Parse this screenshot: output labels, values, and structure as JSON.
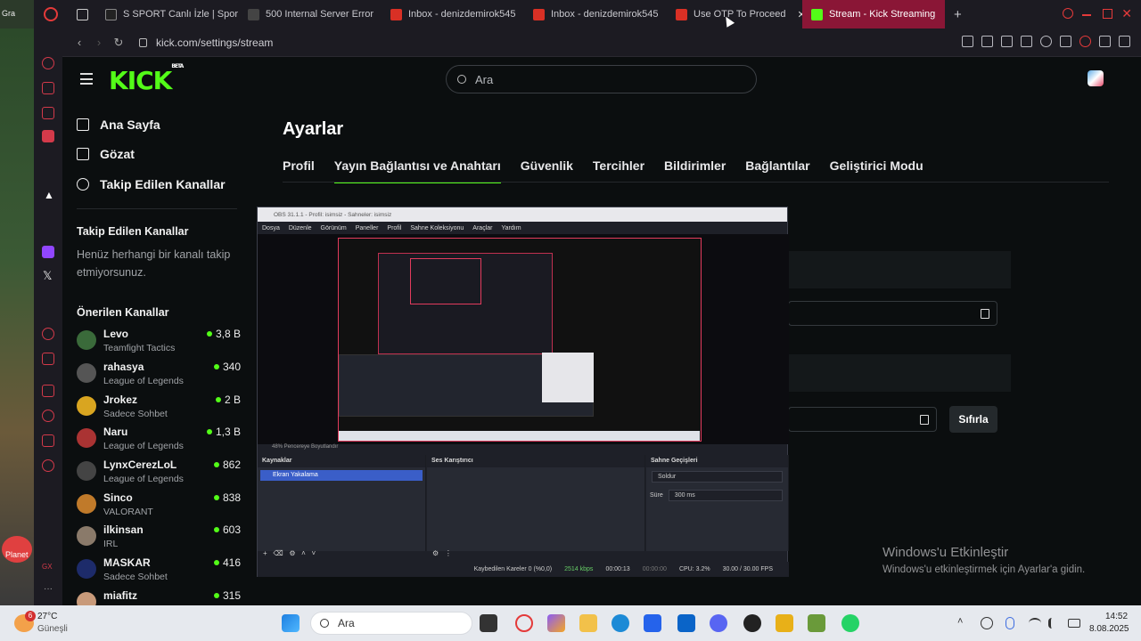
{
  "browser": {
    "tabs": [
      {
        "label": "S SPORT Canlı İzle | Spor",
        "color": "#222222"
      },
      {
        "label": "500 Internal Server Error",
        "color": "#444444"
      },
      {
        "label": "Inbox - denizdemirok545",
        "color": "#d93025"
      },
      {
        "label": "Inbox - denizdemirok545",
        "color": "#d93025"
      },
      {
        "label": "Use OTP To Proceed",
        "color": "#d93025"
      },
      {
        "label": "Stream - Kick Streaming",
        "color": "#53fc18"
      }
    ],
    "left_strip_label": "Gra",
    "url": "kick.com/settings/stream"
  },
  "kick": {
    "logo": "KICK",
    "logo_sup": "BETA",
    "search_placeholder": "Ara",
    "nav": {
      "home": "Ana Sayfa",
      "browse": "Gözat",
      "following": "Takip Edilen Kanallar"
    },
    "following_title": "Takip Edilen Kanallar",
    "following_empty": "Henüz herhangi bir kanalı takip etmiyorsunuz.",
    "recommended_title": "Önerilen Kanallar",
    "channels": [
      {
        "name": "Levo",
        "game": "Teamfight Tactics",
        "viewers": "3,8 B",
        "color": "#3a6a3a"
      },
      {
        "name": "rahasya",
        "game": "League of Legends",
        "viewers": "340",
        "color": "#555555"
      },
      {
        "name": "Jrokez",
        "game": "Sadece Sohbet",
        "viewers": "2 B",
        "color": "#d9a520"
      },
      {
        "name": "Naru",
        "game": "League of Legends",
        "viewers": "1,3 B",
        "color": "#a33"
      },
      {
        "name": "LynxCerezLoL",
        "game": "League of Legends",
        "viewers": "862",
        "color": "#444"
      },
      {
        "name": "Sinco",
        "game": "VALORANT",
        "viewers": "838",
        "color": "#c07a2a"
      },
      {
        "name": "ilkinsan",
        "game": "IRL",
        "viewers": "603",
        "color": "#8a7a6a"
      },
      {
        "name": "MASKAR",
        "game": "Sadece Sohbet",
        "viewers": "416",
        "color": "#1d2b6a"
      },
      {
        "name": "miafitz",
        "game": "",
        "viewers": "315",
        "color": "#c89a7a"
      }
    ],
    "settings_title": "Ayarlar",
    "settings_tabs": [
      "Profil",
      "Yayın Bağlantısı ve Anahtarı",
      "Güvenlik",
      "Tercihler",
      "Bildirimler",
      "Bağlantılar",
      "Geliştirici Modu"
    ],
    "reset_label": "Sıfırla"
  },
  "obs": {
    "title": "OBS 31.1.1 - Profil: isimsiz - Sahneler: isimsiz",
    "menu": [
      "Dosya",
      "Düzenle",
      "Görünüm",
      "Paneller",
      "Profil",
      "Sahne Koleksiyonu",
      "Araçlar",
      "Yardım"
    ],
    "zoom_text": "48%   Pencereye Boyutlandır",
    "docks": {
      "sources": "Kaynaklar",
      "mixer": "Ses Karıştırıcı",
      "transitions": "Sahne Geçişleri"
    },
    "source_item": "Ekran Yakalama",
    "transition": "Soldur",
    "duration_label": "Süre",
    "duration": "300 ms",
    "status": {
      "dropped": "Kaybedilen Kareler 0 (%0,0)",
      "bitrate": "2514 kbps",
      "time": "00:00:13",
      "rec": "00:00:00",
      "cpu": "CPU: 3.2%",
      "fps": "30.00 / 30.00 FPS"
    }
  },
  "watermark": {
    "title": "Windows'u Etkinleştir",
    "subtitle": "Windows'u etkinleştirmek için Ayarlar'a gidin."
  },
  "taskbar": {
    "weather_temp": "27°C",
    "weather_desc": "Güneşli",
    "weather_badge": "6",
    "search": "Ara",
    "time": "14:52",
    "date": "8.08.2025",
    "desktop_label": "Planet"
  }
}
